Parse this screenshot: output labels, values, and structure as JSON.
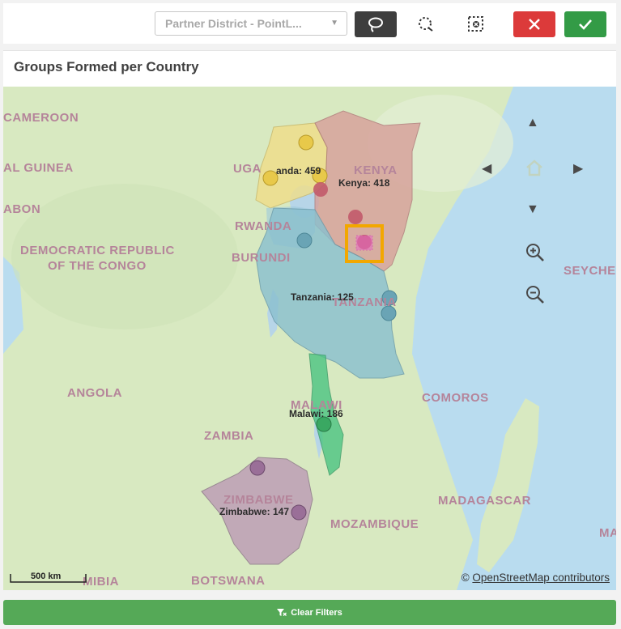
{
  "toolbar": {
    "field_select": "Partner District - PointL...",
    "lasso_tool": "lasso-select",
    "circle_tool": "circle-select",
    "clear_selection_tool": "clear-selection",
    "cancel": "cancel",
    "confirm": "confirm"
  },
  "panel": {
    "title": "Groups Formed per Country"
  },
  "map": {
    "country_labels": {
      "cameroon": "CAMEROON",
      "guinea": "AL GUINEA",
      "gabon": "ABON",
      "drc_1": "DEMOCRATIC REPUBLIC",
      "drc_2": "OF THE CONGO",
      "uganda": "UGA",
      "kenya": "KENYA",
      "rwanda": "RWANDA",
      "burundi": "BURUNDI",
      "tanzania": "TANZANIA",
      "angola": "ANGOLA",
      "zambia": "ZAMBIA",
      "malawi": "MALAWI",
      "comoros": "COMOROS",
      "madagascar": "MADAGASCAR",
      "mozambique": "MOZAMBIQUE",
      "zimbabwe": "ZIMBABWE",
      "botswana": "BOTSWANA",
      "namibia": "MIBIA",
      "seychelles": "SEYCHE",
      "ma": "MA"
    },
    "data_labels": {
      "uganda": "anda: 459",
      "kenya": "Kenya: 418",
      "tanzania": "Tanzania: 125",
      "malawi": "Malawi: 186",
      "zimbabwe": "Zimbabwe: 147"
    },
    "scale": "500 km",
    "attribution_prefix": "©",
    "attribution_link": "OpenStreetMap contributors",
    "colors": {
      "uganda": "#f0de8a",
      "kenya": "#d7a09a",
      "tanzania": "#8ac0cf",
      "malawi": "#4fc584",
      "zimbabwe": "#bd9fb6",
      "selection": "#f2a700"
    }
  },
  "footer": {
    "clear_filters": "Clear Filters"
  }
}
